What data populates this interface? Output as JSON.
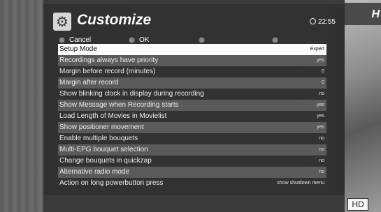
{
  "window": {
    "title": "Customize",
    "clock": "22:55"
  },
  "buttons": [
    {
      "label": "Cancel"
    },
    {
      "label": "OK"
    },
    {
      "label": ""
    },
    {
      "label": ""
    }
  ],
  "settings": [
    {
      "label": "Setup Mode",
      "value": "Expert"
    },
    {
      "label": "Recordings always have priority",
      "value": "yes"
    },
    {
      "label": "Margin before record (minutes)",
      "value": "0"
    },
    {
      "label": "Margin after record",
      "value": "0"
    },
    {
      "label": "Show blinking clock in display during recording",
      "value": "no"
    },
    {
      "label": "Show Message when Recording starts",
      "value": "yes"
    },
    {
      "label": "Load Length of Movies in Movielist",
      "value": "yes"
    },
    {
      "label": "Show positioner movement",
      "value": "yes"
    },
    {
      "label": "Enable multiple bouquets",
      "value": "no"
    },
    {
      "label": "Multi-EPG bouquet selection",
      "value": "no"
    },
    {
      "label": "Change bouquets in quickzap",
      "value": "no"
    },
    {
      "label": "Alternative radio mode",
      "value": "no"
    },
    {
      "label": "Action on long powerbutton press",
      "value": "show shutdown menu"
    }
  ],
  "background": {
    "channel_logo_text": "H",
    "hd_badge": "HD"
  },
  "icons": {
    "gear": "gear-icon",
    "clock": "clock-icon"
  },
  "colors": {
    "panel": "#2f2f2f",
    "selected_row": "#ffffff",
    "alt_row": "#595959"
  }
}
